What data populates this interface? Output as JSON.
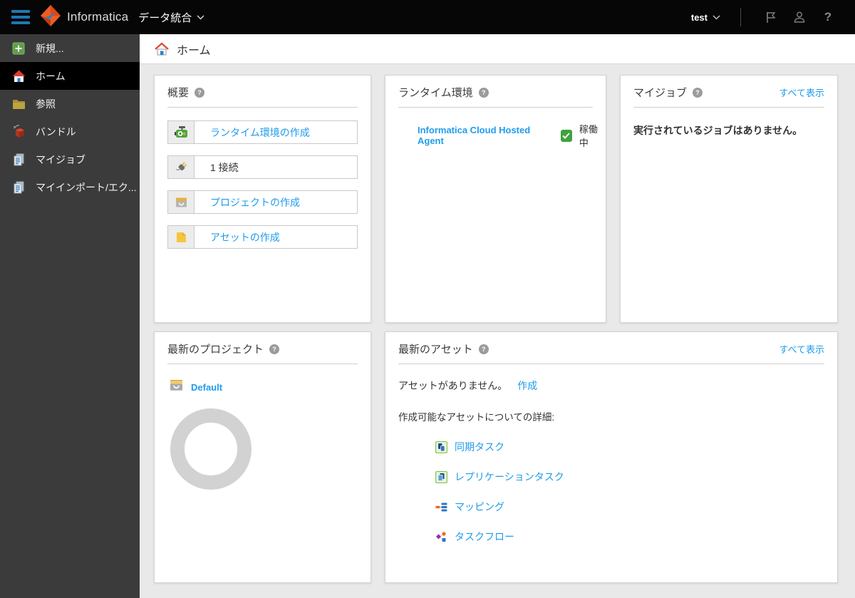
{
  "topbar": {
    "brand": "Informatica",
    "service": "データ統合",
    "user": "test",
    "help_glyph": "?"
  },
  "breadcrumb": {
    "title": "ホーム"
  },
  "sidebar": {
    "items": [
      {
        "label": "新規...",
        "icon": "plus-icon",
        "active": false
      },
      {
        "label": "ホーム",
        "icon": "home-icon",
        "active": true
      },
      {
        "label": "参照",
        "icon": "folder-icon",
        "active": false
      },
      {
        "label": "バンドル",
        "icon": "bundle-icon",
        "active": false
      },
      {
        "label": "マイジョブ",
        "icon": "jobs-icon",
        "active": false
      },
      {
        "label": "マイインポート/エク...",
        "icon": "import-export-icon",
        "active": false
      }
    ]
  },
  "cards": {
    "overview": {
      "title": "概要",
      "rows": [
        {
          "label": "ランタイム環境の作成",
          "icon": "agent-icon",
          "is_link": true
        },
        {
          "label": "1 接続",
          "icon": "connection-icon",
          "is_link": false
        },
        {
          "label": "プロジェクトの作成",
          "icon": "project-icon",
          "is_link": true
        },
        {
          "label": "アセットの作成",
          "icon": "asset-icon",
          "is_link": true
        }
      ]
    },
    "runtime": {
      "title": "ランタイム環境",
      "agent": "Informatica Cloud Hosted Agent",
      "status": "稼働中"
    },
    "jobs": {
      "title": "マイジョブ",
      "view_all": "すべて表示",
      "empty": "実行されているジョブはありません。"
    },
    "projects": {
      "title": "最新のプロジェクト",
      "project": "Default"
    },
    "assets": {
      "title": "最新のアセット",
      "view_all": "すべて表示",
      "empty": "アセットがありません。",
      "create": "作成",
      "details_label": "作成可能なアセットについての詳細:",
      "types": [
        {
          "label": "同期タスク",
          "icon": "sync-task-icon"
        },
        {
          "label": "レプリケーションタスク",
          "icon": "replication-task-icon"
        },
        {
          "label": "マッピング",
          "icon": "mapping-icon"
        },
        {
          "label": "タスクフロー",
          "icon": "taskflow-icon"
        }
      ]
    }
  },
  "colors": {
    "link": "#1f9ceb",
    "success_green": "#3fa23c",
    "topbar_bg": "#060606",
    "sidebar_bg": "#3b3b3b",
    "content_bg": "#e9e9e9",
    "hamburger_blue": "#1c79b5"
  },
  "status_check_glyph": "✓"
}
